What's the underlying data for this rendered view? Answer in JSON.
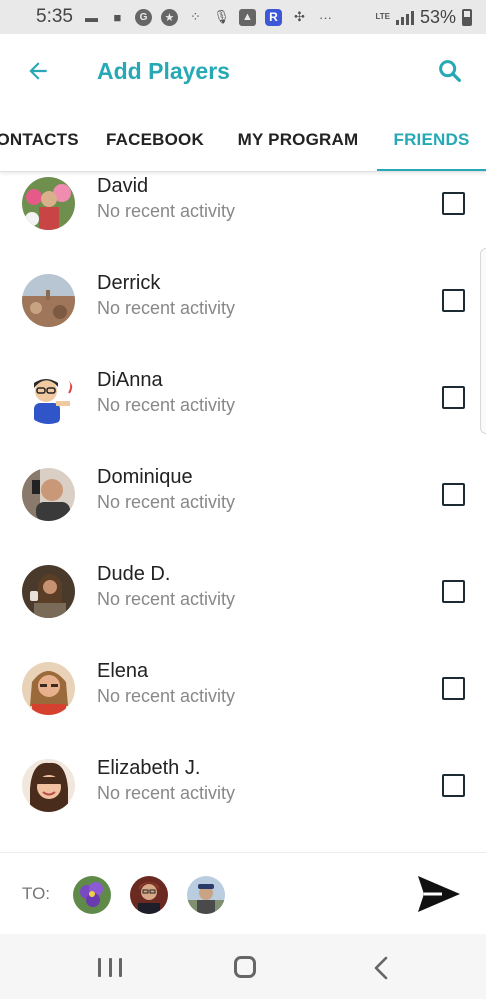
{
  "status_bar": {
    "time": "5:35",
    "battery": "53%",
    "network": "LTE",
    "overflow": "···",
    "icons": [
      "sim-icon",
      "message-icon",
      "gear-notification-icon",
      "star-icon",
      "grid-icon",
      "mic-icon",
      "image-icon",
      "r-app-icon",
      "pinwheel-icon",
      "signal-icon",
      "battery-icon"
    ]
  },
  "app_bar": {
    "title": "Add Players",
    "back_icon": "arrow-left-icon",
    "search_icon": "search-icon",
    "accent_color": "#27a9b5"
  },
  "tabs": [
    {
      "label": "CONTACTS",
      "active": false
    },
    {
      "label": "FACEBOOK",
      "active": false
    },
    {
      "label": "MY PROGRAM",
      "active": false
    },
    {
      "label": "FRIENDS",
      "active": true
    }
  ],
  "friends": [
    {
      "name": "David",
      "activity": "No recent activity",
      "checked": false
    },
    {
      "name": "Derrick",
      "activity": "No recent activity",
      "checked": false
    },
    {
      "name": "DiAnna",
      "activity": "No recent activity",
      "checked": false
    },
    {
      "name": "Dominique",
      "activity": "No recent activity",
      "checked": false
    },
    {
      "name": "Dude D.",
      "activity": "No recent activity",
      "checked": false
    },
    {
      "name": "Elena",
      "activity": "No recent activity",
      "checked": false
    },
    {
      "name": "Elizabeth J.",
      "activity": "No recent activity",
      "checked": false
    }
  ],
  "to_bar": {
    "label": "TO:",
    "selected_count": 3,
    "send_icon": "send-icon"
  },
  "nav_bar": {
    "icons": [
      "recent-apps-icon",
      "home-icon",
      "back-icon"
    ]
  }
}
